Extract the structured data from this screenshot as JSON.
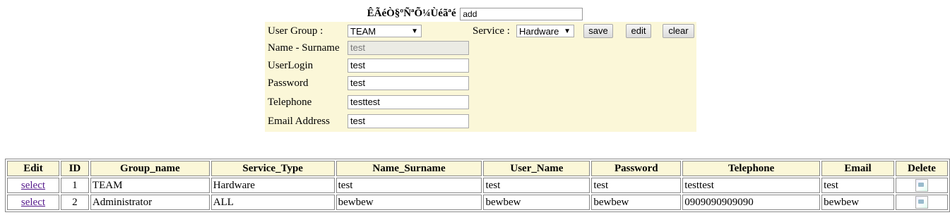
{
  "header": {
    "title": "ÊÃéÒ§ºÑ­ªÕ¼Ùéãªé",
    "status_value": "add"
  },
  "form": {
    "user_group_label": "User Group :",
    "user_group_value": "TEAM",
    "service_label": "Service :",
    "service_value": "Hardware",
    "save_label": "save",
    "edit_label": "edit",
    "clear_label": "clear",
    "name_label": "Name - Surname",
    "name_value": "test",
    "login_label": "UserLogin",
    "login_value": "test",
    "password_label": "Password",
    "password_value": "test",
    "telephone_label": "Telephone",
    "telephone_value": "testtest",
    "email_label": "Email Address",
    "email_value": "test"
  },
  "table": {
    "headers": [
      "Edit",
      "ID",
      "Group_name",
      "Service_Type",
      "Name_Surname",
      "User_Name",
      "Password",
      "Telephone",
      "Email",
      "Delete"
    ],
    "rows": [
      {
        "edit": "select",
        "id": "1",
        "group": "TEAM",
        "service": "Hardware",
        "name": "test",
        "user": "test",
        "password": "test",
        "telephone": "testtest",
        "email": "test"
      },
      {
        "edit": "select",
        "id": "2",
        "group": "Administrator",
        "service": "ALL",
        "name": "bewbew",
        "user": "bewbew",
        "password": "bewbew",
        "telephone": "0909090909090",
        "email": "bewbew"
      }
    ]
  },
  "icons": {
    "dropdown": "chevron-down-icon",
    "delete": "broken-image-icon"
  }
}
